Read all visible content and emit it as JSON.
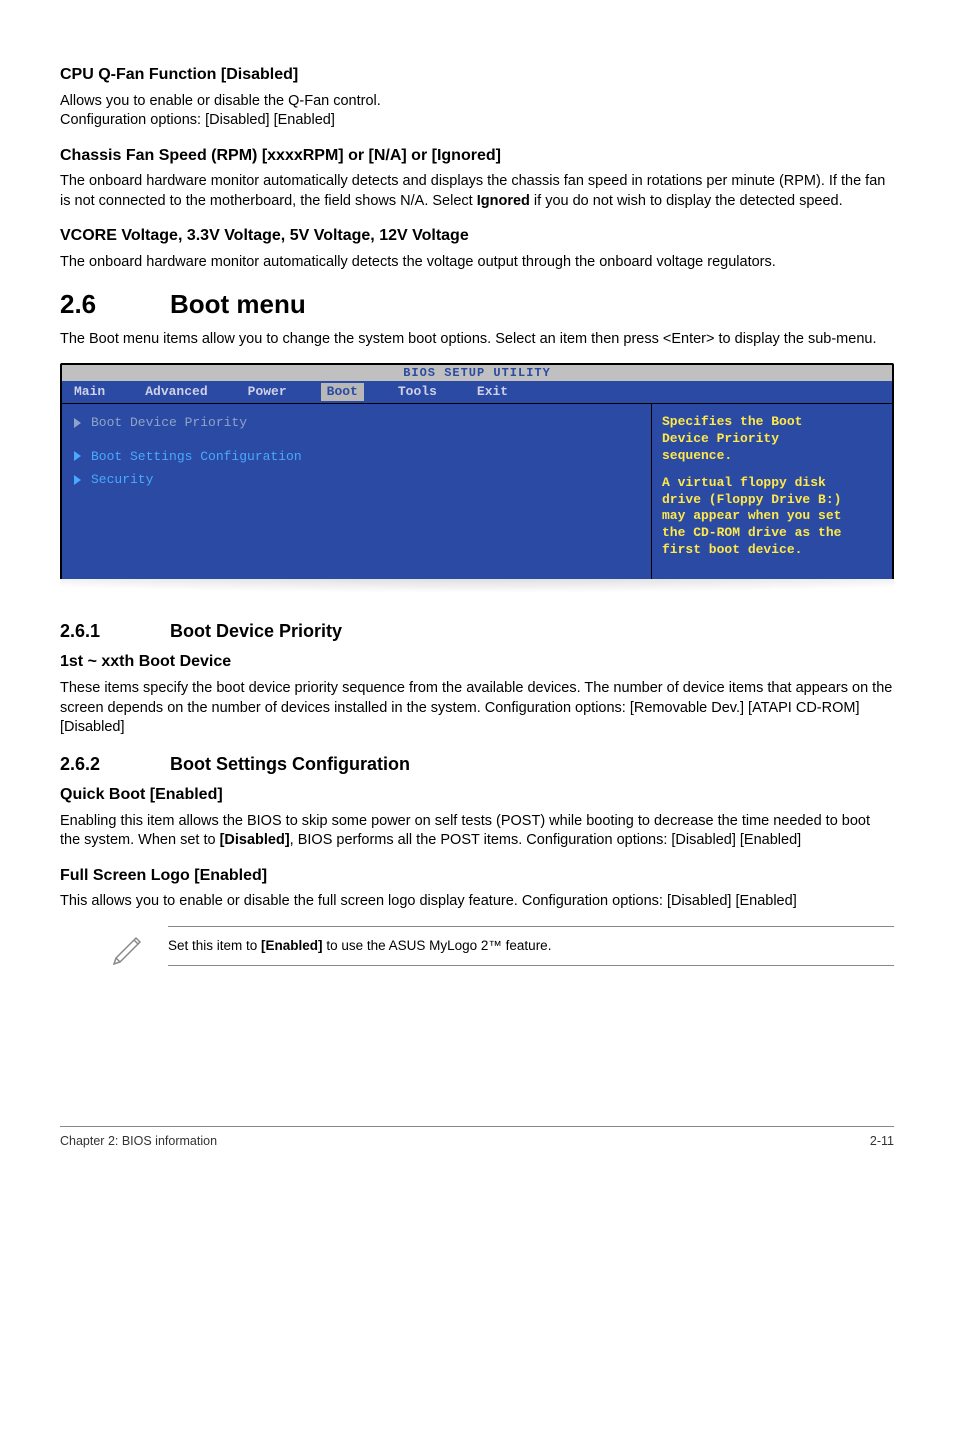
{
  "s1": {
    "h": "CPU Q-Fan Function [Disabled]",
    "p1": "Allows you to enable or disable the Q-Fan control.",
    "p2": "Configuration options: [Disabled] [Enabled]"
  },
  "s2": {
    "h": "Chassis Fan Speed (RPM) [xxxxRPM] or [N/A] or [Ignored]",
    "p_a": "The onboard hardware monitor automatically detects and displays the chassis fan speed in rotations per minute (RPM). If the fan is not connected to the motherboard, the field shows N/A. Select ",
    "p_b": "Ignored",
    "p_c": " if you do not wish to display the detected speed."
  },
  "s3": {
    "h": "VCORE Voltage, 3.3V Voltage, 5V Voltage, 12V Voltage",
    "p": "The onboard hardware monitor automatically detects the voltage output through the onboard voltage regulators."
  },
  "sec26": {
    "num": "2.6",
    "title": "Boot menu",
    "p": "The Boot menu items allow you to change the system boot options. Select an item then press <Enter> to display the sub-menu."
  },
  "bios": {
    "title": "BIOS SETUP UTILITY",
    "tabs": {
      "main": "Main",
      "adv": "Advanced",
      "power": "Power",
      "boot": "Boot",
      "tools": "Tools",
      "exit": "Exit"
    },
    "left": {
      "r1": "Boot Device Priority",
      "r2": "Boot Settings Configuration",
      "r3": "Security"
    },
    "right": {
      "l1": "Specifies the Boot",
      "l2": "Device Priority",
      "l3": "sequence.",
      "l4": "A virtual floppy disk",
      "l5": "drive (Floppy Drive B:)",
      "l6": "may appear when you set",
      "l7": "the CD-ROM drive as the",
      "l8": "first boot device."
    }
  },
  "sec261": {
    "num": "2.6.1",
    "title": "Boot Device Priority",
    "h": "1st ~ xxth Boot Device",
    "p": "These items specify the boot device priority sequence from the available devices. The number of device items that appears on the screen depends on the number of devices installed in the system. Configuration options: [Removable Dev.] [ATAPI CD-ROM] [Disabled]"
  },
  "sec262": {
    "num": "2.6.2",
    "title": "Boot Settings Configuration"
  },
  "qb": {
    "h": "Quick Boot [Enabled]",
    "p_a": "Enabling this item allows the BIOS to skip some power on self tests (POST) while booting to decrease the time needed to boot the system. When set to ",
    "p_b": "[Disabled]",
    "p_c": ", BIOS performs all the POST items. Configuration options: [Disabled] [Enabled]"
  },
  "fsl": {
    "h": "Full Screen Logo [Enabled]",
    "p": "This allows you to enable or disable the full screen logo display feature. Configuration options: [Disabled] [Enabled]"
  },
  "note": {
    "a": "Set this item to ",
    "b": "[Enabled]",
    "c": " to use the ASUS MyLogo 2™ feature."
  },
  "footer": {
    "left": "Chapter 2: BIOS information",
    "right": "2-11"
  }
}
